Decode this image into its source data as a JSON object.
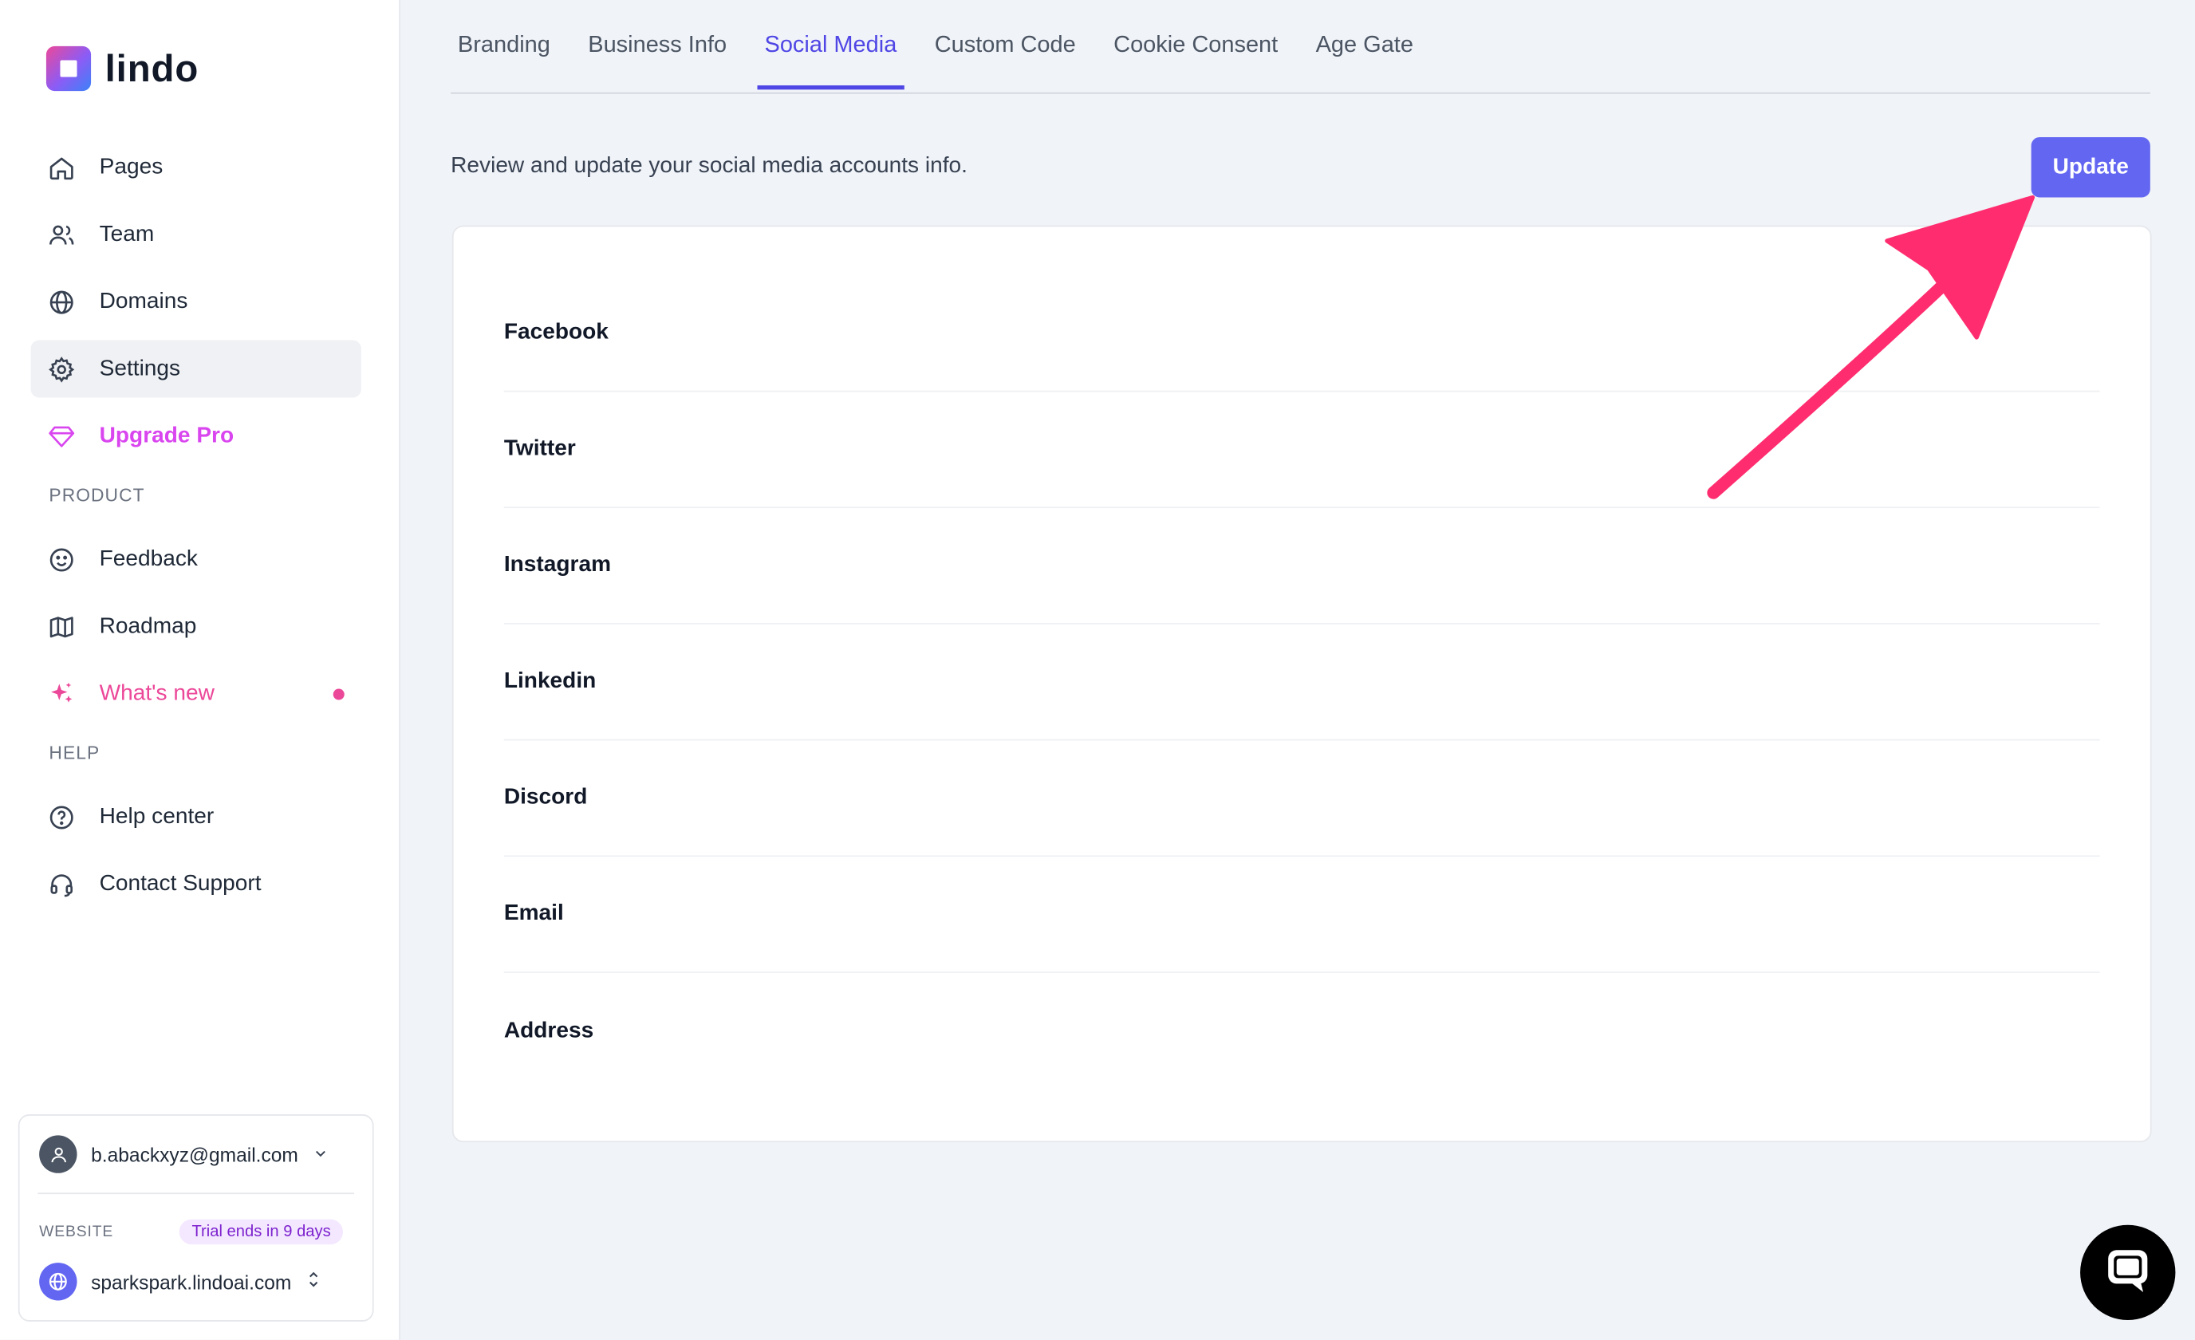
{
  "brand": {
    "name": "lindo"
  },
  "sidebar": {
    "items": [
      {
        "label": "Pages",
        "icon": "home-icon"
      },
      {
        "label": "Team",
        "icon": "users-icon"
      },
      {
        "label": "Domains",
        "icon": "globe-icon"
      },
      {
        "label": "Settings",
        "icon": "gear-icon"
      },
      {
        "label": "Upgrade Pro",
        "icon": "diamond-icon"
      }
    ],
    "product_label": "PRODUCT",
    "product_items": [
      {
        "label": "Feedback",
        "icon": "smiley-icon"
      },
      {
        "label": "Roadmap",
        "icon": "map-icon"
      },
      {
        "label": "What's new",
        "icon": "sparkles-icon"
      }
    ],
    "help_label": "HELP",
    "help_items": [
      {
        "label": "Help center",
        "icon": "question-circle-icon"
      },
      {
        "label": "Contact Support",
        "icon": "headset-icon"
      }
    ]
  },
  "account": {
    "email": "b.abackxyz@gmail.com",
    "website_label": "WEBSITE",
    "trial_badge": "Trial ends in 9 days",
    "site": "sparkspark.lindoai.com"
  },
  "tabs": [
    "Branding",
    "Business Info",
    "Social Media",
    "Custom Code",
    "Cookie Consent",
    "Age Gate"
  ],
  "active_tab": "Social Media",
  "intro": "Review and update your social media accounts info.",
  "update_label": "Update",
  "fields": [
    "Facebook",
    "Twitter",
    "Instagram",
    "Linkedin",
    "Discord",
    "Email",
    "Address"
  ],
  "colors": {
    "accent": "#6366f1",
    "annotation_arrow": "#ff2d6f",
    "pro": "#d946ef",
    "new": "#ec4899"
  }
}
